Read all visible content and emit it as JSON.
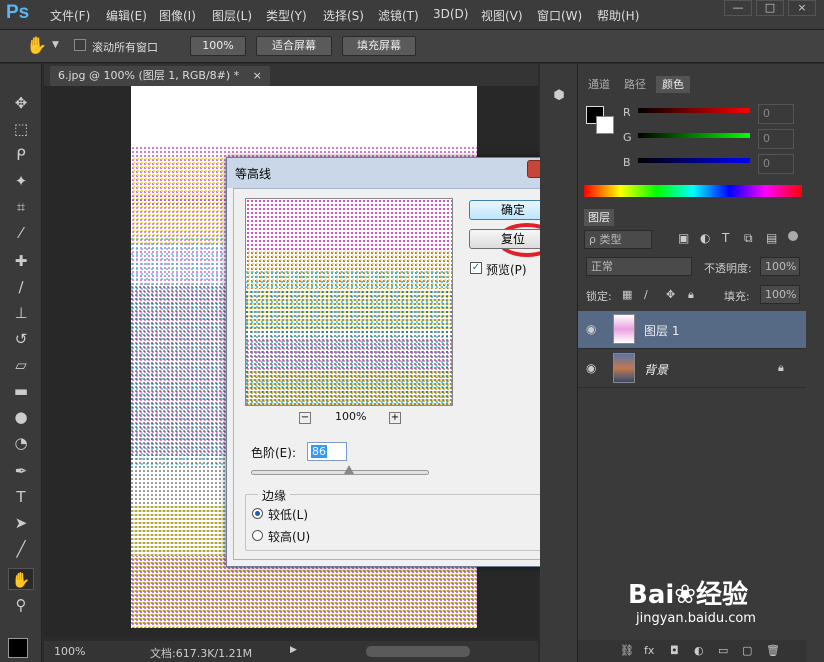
{
  "app": {
    "logo": "Ps"
  },
  "menu": [
    "文件(F)",
    "编辑(E)",
    "图像(I)",
    "图层(L)",
    "类型(Y)",
    "选择(S)",
    "滤镜(T)",
    "3D(D)",
    "视图(V)",
    "窗口(W)",
    "帮助(H)"
  ],
  "window_controls": {
    "minimize": "—",
    "restore": "□",
    "close": "×"
  },
  "options": {
    "scroll_all_label": "滚动所有窗口",
    "zoom_btn": "100%",
    "fit_screen_btn": "适合屏幕",
    "fill_screen_btn": "填充屏幕"
  },
  "document": {
    "tab_title": "6.jpg @ 100% (图层 1, RGB/8#) *",
    "tab_close": "×"
  },
  "status": {
    "zoom": "100%",
    "doc_info": "文档:617.3K/1.21M"
  },
  "dialog": {
    "title": "等高线",
    "close": "x",
    "ok_btn": "确定",
    "reset_btn": "复位",
    "preview_label": "预览(P)",
    "preview_checked": true,
    "zoom_minus": "−",
    "zoom_plus": "+",
    "zoom_value": "100%",
    "levels_label": "色阶(E):",
    "levels_value": "86",
    "levels_slider_fraction": 0.55,
    "edge_group_label": "边缘",
    "edge_low_label": "较低(L)",
    "edge_high_label": "较高(U)",
    "edge_selected": "low"
  },
  "color_panel": {
    "tabs": [
      "通道",
      "路径",
      "颜色"
    ],
    "active_tab": "颜色",
    "channels": [
      {
        "label": "R",
        "value": "0"
      },
      {
        "label": "G",
        "value": "0"
      },
      {
        "label": "B",
        "value": "0"
      }
    ]
  },
  "layers_panel": {
    "tab": "图层",
    "filter_kind": "ρ 类型",
    "blend_mode": "正常",
    "opacity_label": "不透明度:",
    "opacity_value": "100%",
    "lock_label": "锁定:",
    "fill_label": "填充:",
    "fill_value": "100%",
    "layers": [
      {
        "name": "图层 1",
        "selected": true
      },
      {
        "name": "背景",
        "selected": false,
        "locked": true
      }
    ]
  },
  "watermark": {
    "text": "Bai❀经验",
    "url": "jingyan.baidu.com"
  },
  "colors": {
    "accent_selection": "#566a86",
    "ok_highlight": "#e0212a",
    "ps_blue": "#58b6f2"
  }
}
